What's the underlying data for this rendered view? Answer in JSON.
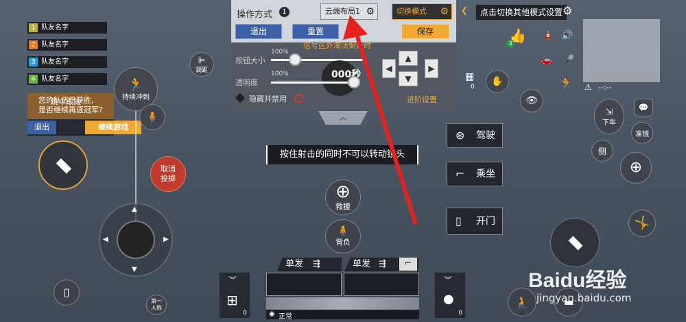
{
  "teammates": [
    {
      "num": "1",
      "name": "队友名字",
      "color": "#b7b33a"
    },
    {
      "num": "2",
      "name": "队友名字",
      "color": "#e07e2c"
    },
    {
      "num": "3",
      "name": "队友名字",
      "color": "#2ba0d6"
    },
    {
      "num": "4",
      "name": "队友名字",
      "color": "#6cb33f"
    }
  ],
  "follow_popup": {
    "title": "跳伞跟随",
    "question": "您的队伍已获胜,\n是否继续再逐冠军?",
    "exit": "退出",
    "continue": "继续游戏"
  },
  "left_buttons": {
    "sprint": "持续冲刺",
    "distance": "调距",
    "cancel_throw": "取消投掷",
    "first_person": "第一人称"
  },
  "panel": {
    "title": "操作方式",
    "mode_num": "1",
    "layout_name": "云端布局1",
    "switch_mode": "切换模式",
    "exit": "退出",
    "reset": "重置",
    "save": "保存",
    "signal_text": "信号区外淘汰倒计时",
    "size_label": "按钮大小",
    "size_value": "100%",
    "opacity_label": "透明度",
    "opacity_value": "100%",
    "hide_label": "隐藏并禁用",
    "advanced": "进阶设置",
    "preview_text": "000秒"
  },
  "hint": "点击切换其他模式设置",
  "center_msg": "按住射击的同时不可以转动镜头",
  "center_buttons": {
    "rescue": "救援",
    "carry": "背负"
  },
  "right_buttons": {
    "drive": "驾驶",
    "ride": "乘坐",
    "open_door": "开门",
    "exit_vehicle": "下车",
    "scope": "准镜",
    "lean": "侧"
  },
  "like_count": "3",
  "weapons": [
    {
      "mode": "单发"
    },
    {
      "mode": "单发"
    }
  ],
  "stance": "正常",
  "medkit_count": "0",
  "grenade_count": "0",
  "box_count": "0",
  "map_time": "--:--",
  "watermark": {
    "brand": "Baidu经验",
    "url": "jingyan.baidu.com"
  },
  "colors": {
    "accent_orange": "#f0a830",
    "blue": "#3d5fa6",
    "red_arrow": "#e8201e",
    "cancel_red": "#c23a2a"
  }
}
